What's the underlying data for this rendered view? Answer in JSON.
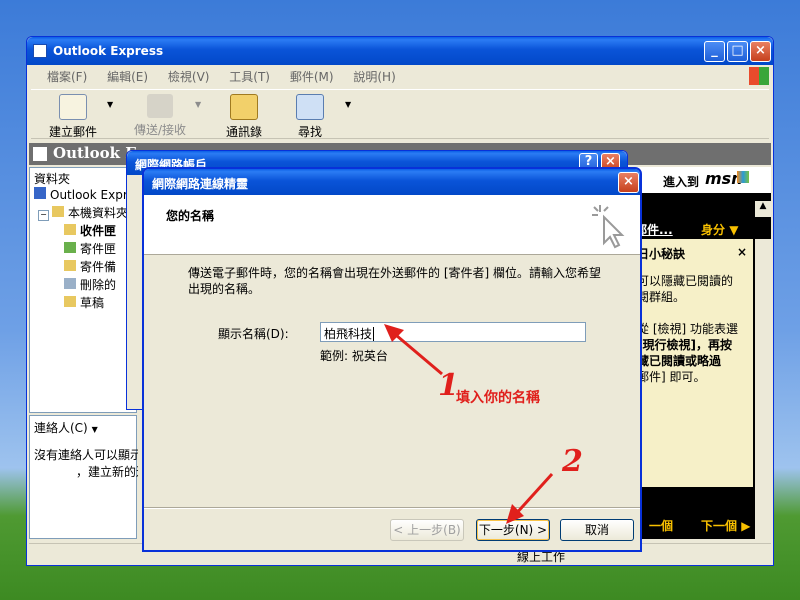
{
  "window": {
    "title": "Outlook Express"
  },
  "menu": [
    "檔案(F)",
    "編輯(E)",
    "檢視(V)",
    "工具(T)",
    "郵件(M)",
    "說明(H)"
  ],
  "toolbar": {
    "create_mail": "建立郵件",
    "send_receive": "傳送/接收",
    "addresses": "通訊錄",
    "find": "尋找"
  },
  "header_bar": {
    "title": "Outlook Ex"
  },
  "folders": {
    "header": "資料夾",
    "items": [
      "Outlook Expres",
      "本機資料夾",
      "收件匣",
      "寄件匣",
      "寄件備",
      "刪除的",
      "草稿"
    ]
  },
  "contacts": {
    "label": "連絡人(C)",
    "empty_line1": "沒有連絡人可以顯示",
    "empty_line2": "，建立新的連"
  },
  "msn_panel": {
    "goto": "進入到",
    "brand": "msn",
    "nav_item": "郵件...",
    "identity": "身分",
    "tip_title": "日小秘訣",
    "tip_lines": [
      "可以隱藏已閱讀的",
      "閱群組。",
      "",
      "從 [檢視] 功能表選",
      "[現行檢視]，再按",
      "藏已閱讀或略過",
      "郵件] 即可。"
    ],
    "prev": "一個",
    "next": "下一個"
  },
  "behind_dialog": {
    "title": "網際網路帳戶"
  },
  "wizard": {
    "title": "網際網路連線精靈",
    "heading": "您的名稱",
    "description": "傳送電子郵件時，您的名稱會出現在外送郵件的 [寄件者] 欄位。請輸入您希望出現的名稱。",
    "display_name_label": "顯示名稱(D):",
    "display_name_value": "柏飛科技",
    "example": "範例: 祝英台",
    "back": "< 上一步(B)",
    "next": "下一步(N) >",
    "cancel": "取消"
  },
  "annotations": {
    "step1_number": "1",
    "step1_text": "填入你的名稱",
    "step2_number": "2",
    "color": "#e0201c"
  },
  "status_bar": {
    "text": "線上工作"
  }
}
